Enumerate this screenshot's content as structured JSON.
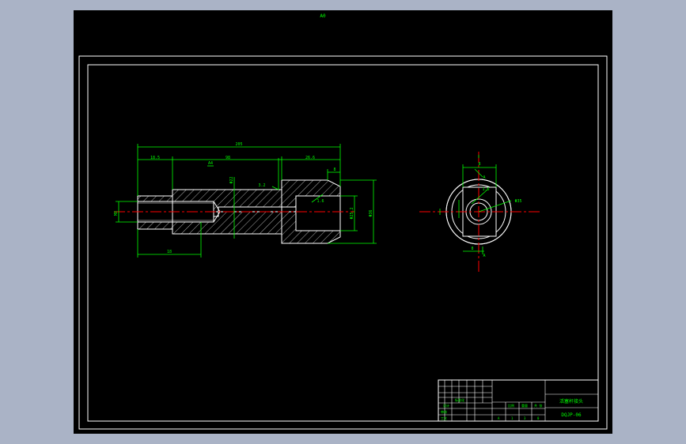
{
  "drawing": {
    "top_note": "A0",
    "colors": {
      "background": "#000000",
      "frame": "#ffffff",
      "part": "#ffffff",
      "hatch": "#e8e8e8",
      "dimension": "#00ff00",
      "centerline": "#ff0000",
      "text": "#00ff00"
    }
  },
  "section_view": {
    "dims": {
      "overall_length": "205",
      "left_step": "18.5",
      "middle_length": "98",
      "right_step": "26.6",
      "bore_left_depth": "18",
      "left_bore_dia": "M8",
      "mid_dia": "Φ22",
      "right_outer_dia": "Φ36",
      "right_bore_dia": "Φ25.2",
      "chamfer": "8",
      "surface_finish_1": "3.2",
      "surface_finish_2": "1.6",
      "tolerance": "A4"
    }
  },
  "end_view": {
    "dims": {
      "width_top": "8",
      "width_bottom": "8",
      "outer_dia": "Φ35",
      "inner_mark": "1.6"
    },
    "section_labels": {
      "top": "A",
      "bottom": "A"
    }
  },
  "title_block": {
    "part_name": "活塞杆接头",
    "drawing_number": "DQJP-06",
    "cells": {
      "designer": "设计",
      "standard": "标准化",
      "review": "审核",
      "process": "工艺",
      "scale_label": "比例",
      "weight_label": "重量",
      "sheet_label": "共 张",
      "mark_a": "A",
      "mark_b": "1",
      "mark_c": "3",
      "mark_d": "0"
    }
  }
}
